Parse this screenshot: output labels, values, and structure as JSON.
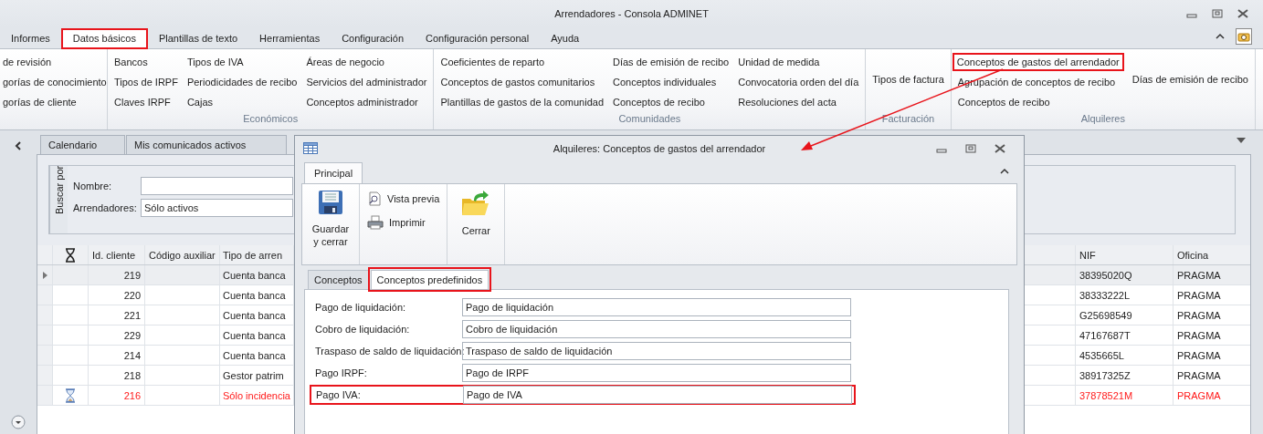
{
  "window": {
    "title": "Arrendadores - Consola ADMINET"
  },
  "menu_tabs": [
    {
      "label": "Informes",
      "selected": false,
      "highlighted": false
    },
    {
      "label": "Datos básicos",
      "selected": true,
      "highlighted": true
    },
    {
      "label": "Plantillas de texto",
      "selected": false,
      "highlighted": false
    },
    {
      "label": "Herramientas",
      "selected": false,
      "highlighted": false
    },
    {
      "label": "Configuración",
      "selected": false,
      "highlighted": false
    },
    {
      "label": "Configuración personal",
      "selected": false,
      "highlighted": false
    },
    {
      "label": "Ayuda",
      "selected": false,
      "highlighted": false
    }
  ],
  "ribbon_groups": [
    {
      "columns": [
        [
          {
            "label": "de revisión",
            "highlighted": false
          },
          {
            "label": "gorías de conocimiento",
            "highlighted": false
          },
          {
            "label": "gorías de cliente",
            "highlighted": false
          }
        ]
      ]
    },
    {
      "label": "Económicos",
      "columns": [
        [
          {
            "label": "Bancos",
            "highlighted": false
          },
          {
            "label": "Tipos de IRPF",
            "highlighted": false
          },
          {
            "label": "Claves IRPF",
            "highlighted": false
          }
        ],
        [
          {
            "label": "Tipos de IVA",
            "highlighted": false
          },
          {
            "label": "Periodicidades de recibo",
            "highlighted": false
          },
          {
            "label": "Cajas",
            "highlighted": false
          }
        ],
        [
          {
            "label": "Áreas de negocio",
            "highlighted": false
          },
          {
            "label": "Servicios del administrador",
            "highlighted": false
          },
          {
            "label": "Conceptos administrador",
            "highlighted": false
          }
        ]
      ]
    },
    {
      "label": "Comunidades",
      "columns": [
        [
          {
            "label": "Coeficientes de reparto",
            "highlighted": false
          },
          {
            "label": "Conceptos de gastos comunitarios",
            "highlighted": false
          },
          {
            "label": "Plantillas de gastos de la comunidad",
            "highlighted": false
          }
        ],
        [
          {
            "label": "Días de emisión de recibo",
            "highlighted": false
          },
          {
            "label": "Conceptos individuales",
            "highlighted": false
          },
          {
            "label": "Conceptos de recibo",
            "highlighted": false
          }
        ],
        [
          {
            "label": "Unidad de medida",
            "highlighted": false
          },
          {
            "label": "Convocatoria orden del día",
            "highlighted": false
          },
          {
            "label": "Resoluciones del acta",
            "highlighted": false
          }
        ]
      ]
    },
    {
      "label": "Facturación",
      "columns": [
        [
          {
            "label": "Tipos de factura",
            "highlighted": false
          }
        ]
      ]
    },
    {
      "label": "Alquileres",
      "columns": [
        [
          {
            "label": "Conceptos de gastos del arrendador",
            "highlighted": true
          },
          {
            "label": "Agrupación de conceptos de recibo",
            "highlighted": false
          },
          {
            "label": "Conceptos de recibo",
            "highlighted": false
          }
        ],
        [
          {
            "label": "Días de emisión de recibo",
            "highlighted": false
          }
        ]
      ]
    }
  ],
  "content_tabs": [
    {
      "label": "Calendario",
      "selected": false
    },
    {
      "label": "Mis comunicados activos",
      "selected": false
    }
  ],
  "search": {
    "group_label": "Buscar por",
    "fields": [
      {
        "label": "Nombre:"
      },
      {
        "label": "Arrendadores:",
        "value": "Sólo activos"
      }
    ]
  },
  "grid": {
    "columns": [
      "Id. cliente",
      "Código auxiliar",
      "Tipo de arren",
      "NIF",
      "Oficina"
    ],
    "rows": [
      {
        "id": "219",
        "tipo": "Cuenta banca",
        "nif": "38395020Q",
        "oficina": "PRAGMA",
        "selected": true,
        "alert": false
      },
      {
        "id": "220",
        "tipo": "Cuenta banca",
        "nif": "38333222L",
        "oficina": "PRAGMA",
        "selected": false,
        "alert": false
      },
      {
        "id": "221",
        "tipo": "Cuenta banca",
        "nif": "G25698549",
        "oficina": "PRAGMA",
        "selected": false,
        "alert": false
      },
      {
        "id": "229",
        "tipo": "Cuenta banca",
        "nif": "47167687T",
        "oficina": "PRAGMA",
        "selected": false,
        "alert": false
      },
      {
        "id": "214",
        "tipo": "Cuenta banca",
        "nif": "4535665L",
        "oficina": "PRAGMA",
        "selected": false,
        "alert": false
      },
      {
        "id": "218",
        "tipo": "Gestor patrim",
        "nif": "38917325Z",
        "oficina": "PRAGMA",
        "selected": false,
        "alert": false
      },
      {
        "id": "216",
        "tipo": "Sólo incidencia",
        "nif": "37878521M",
        "oficina": "PRAGMA",
        "selected": false,
        "alert": true
      }
    ]
  },
  "dialog": {
    "title": "Alquileres: Conceptos de gastos del arrendador",
    "ribbon_tab": {
      "label": "Principal",
      "selected": true
    },
    "action_groups": [
      [
        {
          "kind": "save",
          "label": "Guardar y cerrar"
        }
      ],
      [
        {
          "kind": "preview",
          "label": "Vista previa"
        },
        {
          "kind": "print",
          "label": "Imprimir"
        }
      ],
      [
        {
          "kind": "close",
          "label": "Cerrar"
        }
      ]
    ],
    "tabs": [
      {
        "label": "Conceptos",
        "selected": false,
        "highlighted": false
      },
      {
        "label": "Conceptos predefinidos",
        "selected": true,
        "highlighted": true
      }
    ],
    "fields": [
      {
        "label": "Pago de liquidación:",
        "value": "Pago de liquidación",
        "highlighted": false
      },
      {
        "label": "Cobro de liquidación:",
        "value": "Cobro de liquidación",
        "highlighted": false
      },
      {
        "label": "Traspaso de saldo de liquidación:",
        "value": "Traspaso de saldo de liquidación",
        "highlighted": false
      },
      {
        "label": "Pago IRPF:",
        "value": "Pago de IRPF",
        "highlighted": false
      },
      {
        "label": "Pago IVA:",
        "value": "Pago de IVA",
        "highlighted": true
      }
    ]
  }
}
